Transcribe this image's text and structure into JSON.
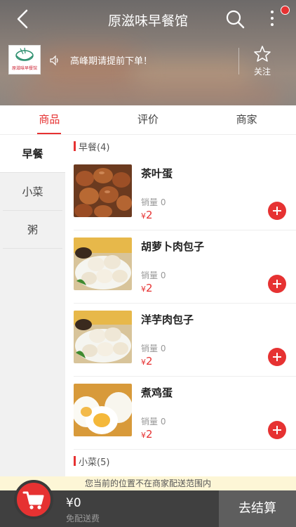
{
  "header": {
    "title": "原滋味早餐馆",
    "notice": "高峰期请提前下单！",
    "follow_label": "关注",
    "logo_text": "原滋味早餐馆"
  },
  "tabs": [
    {
      "label": "商品",
      "active": true
    },
    {
      "label": "评价",
      "active": false
    },
    {
      "label": "商家",
      "active": false
    }
  ],
  "categories": [
    {
      "label": "早餐",
      "active": true
    },
    {
      "label": "小菜",
      "active": false
    },
    {
      "label": "粥",
      "active": false
    }
  ],
  "sections": [
    {
      "title": "早餐(4)",
      "items": [
        {
          "name": "茶叶蛋",
          "sales": "销量 0",
          "currency": "¥",
          "price": "2",
          "image": "tea-egg-image"
        },
        {
          "name": "胡萝卜肉包子",
          "sales": "销量 0",
          "currency": "¥",
          "price": "2",
          "image": "carrot-pork-bun-image"
        },
        {
          "name": "洋芋肉包子",
          "sales": "销量 0",
          "currency": "¥",
          "price": "2",
          "image": "potato-pork-bun-image"
        },
        {
          "name": "煮鸡蛋",
          "sales": "销量 0",
          "currency": "¥",
          "price": "2",
          "image": "boiled-egg-image"
        }
      ]
    },
    {
      "title": "小菜(5)",
      "items": []
    }
  ],
  "footer": {
    "range_tip": "您当前的位置不在商家配送范围内",
    "total": "¥0",
    "delivery": "免配送费",
    "checkout_label": "去结算"
  },
  "colors": {
    "accent": "#e63232",
    "cart_bar": "#404040",
    "checkout": "#5e5e5e",
    "tip_bg": "#fdf6d6"
  },
  "icons": [
    "back-arrow-icon",
    "search-icon",
    "more-vertical-icon",
    "speaker-icon",
    "star-outline-icon",
    "add-icon",
    "shopping-cart-icon"
  ]
}
